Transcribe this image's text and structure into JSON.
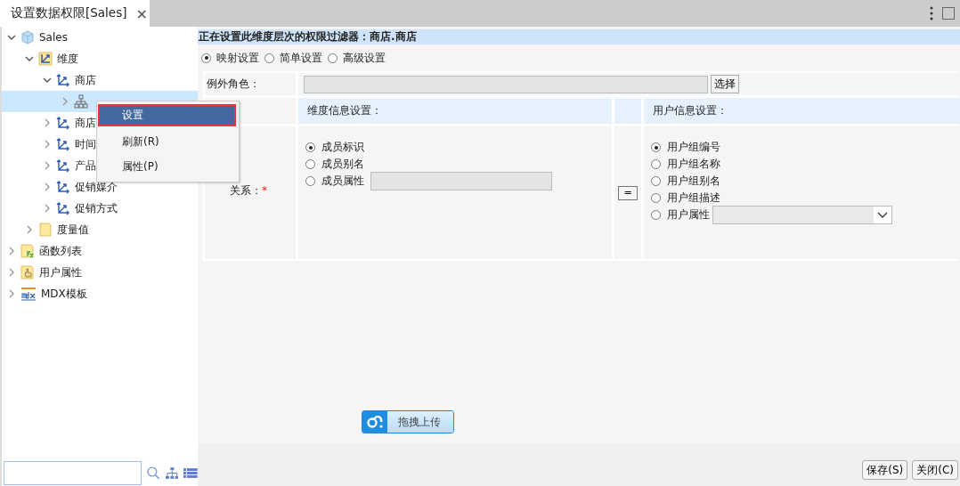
{
  "tab": {
    "title": "设置数据权限[Sales]",
    "close": "×"
  },
  "tree": [
    {
      "label": "Sales",
      "kind": "cube",
      "expanded": true,
      "selected": false,
      "children": [
        {
          "label": "维度",
          "kind": "dimension",
          "expanded": true,
          "selected": false,
          "children": [
            {
              "label": "商店",
              "kind": "hierarchy",
              "expanded": true,
              "selected": false,
              "children": [
                {
                  "kind": "level",
                  "expanded": false,
                  "selected": true
                }
              ]
            },
            {
              "label": "商店",
              "kind": "hierarchy",
              "expanded": false,
              "selected": false
            },
            {
              "label": "时间",
              "kind": "hierarchy",
              "expanded": false,
              "selected": false
            },
            {
              "label": "产品",
              "kind": "hierarchy",
              "expanded": false,
              "selected": false
            },
            {
              "label": "促销媒介",
              "kind": "hierarchy",
              "expanded": false,
              "selected": false
            },
            {
              "label": "促销方式",
              "kind": "hierarchy",
              "expanded": false,
              "selected": false
            }
          ]
        },
        {
          "label": "度量值",
          "kind": "folder",
          "expanded": false,
          "selected": false
        }
      ]
    },
    {
      "label": "函数列表",
      "kind": "function",
      "expanded": false,
      "selected": false
    },
    {
      "label": "用户属性",
      "kind": "hand",
      "expanded": false,
      "selected": false
    },
    {
      "label": "MDX模板",
      "kind": "mdx",
      "expanded": false,
      "selected": false
    }
  ],
  "context_menu": [
    {
      "label": "设置",
      "selected": true
    },
    {
      "label": "刷新(R)",
      "selected": false
    },
    {
      "label": "属性(P)",
      "selected": false
    }
  ],
  "filter_header": "正在设置此维度层次的权限过滤器：商店.商店",
  "modes": [
    {
      "label": "映射设置",
      "selected": true
    },
    {
      "label": "简单设置",
      "selected": false
    },
    {
      "label": "高级设置",
      "selected": false
    }
  ],
  "exception_role": {
    "label": "例外角色：",
    "button": "选择"
  },
  "mapping": {
    "label": "关系：",
    "required": "*",
    "dimension_header": "维度信息设置：",
    "equals": "=",
    "user_header": "用户信息设置：",
    "dimension_options": [
      {
        "label": "成员标识",
        "selected": true,
        "kind": "plain"
      },
      {
        "label": "成员别名",
        "selected": false,
        "kind": "plain"
      },
      {
        "label": "成员属性",
        "selected": false,
        "kind": "field"
      }
    ],
    "user_options": [
      {
        "label": "用户组编号",
        "selected": true,
        "kind": "plain"
      },
      {
        "label": "用户组名称",
        "selected": false,
        "kind": "plain"
      },
      {
        "label": "用户组别名",
        "selected": false,
        "kind": "plain"
      },
      {
        "label": "用户组描述",
        "selected": false,
        "kind": "plain"
      },
      {
        "label": "用户属性",
        "selected": false,
        "kind": "dropdown"
      }
    ]
  },
  "upload_button": "拖拽上传",
  "buttons": [
    "保存(S)",
    "关闭(C)"
  ]
}
